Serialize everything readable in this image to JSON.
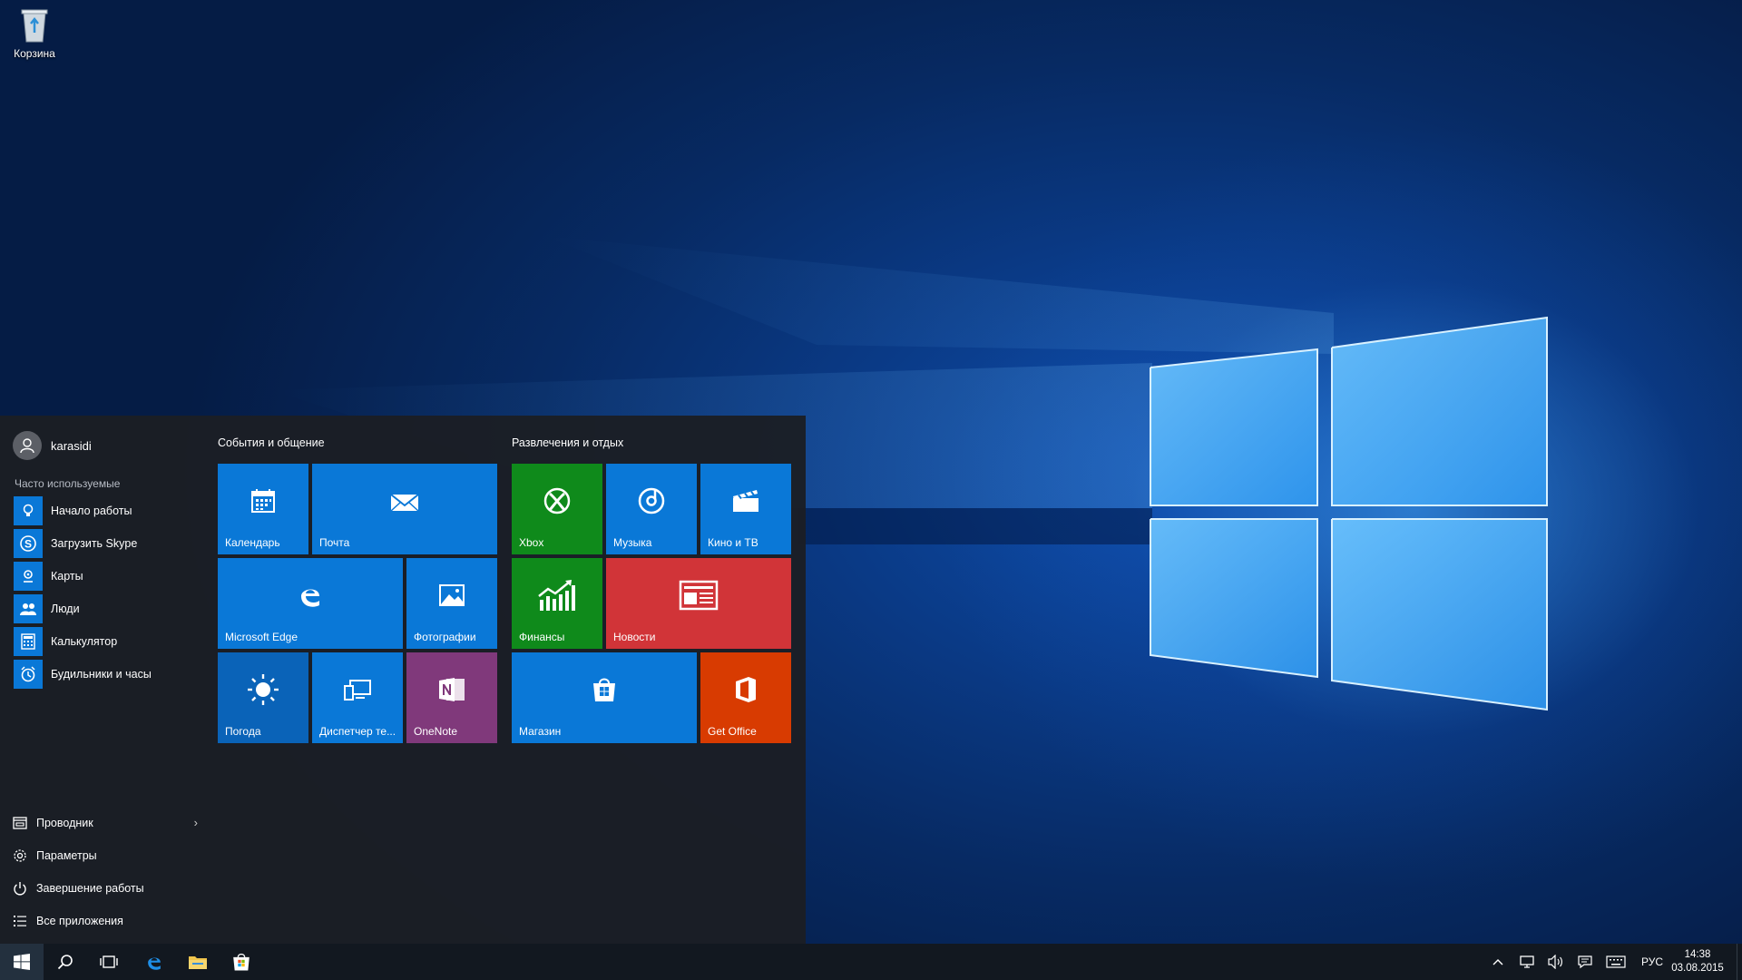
{
  "desktop": {
    "recycle_bin_label": "Корзина"
  },
  "start_menu": {
    "user_name": "karasidi",
    "frequent_title": "Часто используемые",
    "frequent_apps": [
      {
        "label": "Начало работы",
        "icon": "lightbulb-icon"
      },
      {
        "label": "Загрузить Skype",
        "icon": "skype-icon"
      },
      {
        "label": "Карты",
        "icon": "maps-icon"
      },
      {
        "label": "Люди",
        "icon": "people-icon"
      },
      {
        "label": "Калькулятор",
        "icon": "calculator-icon"
      },
      {
        "label": "Будильники и часы",
        "icon": "alarm-clock-icon"
      }
    ],
    "bottom_items": [
      {
        "label": "Проводник",
        "icon": "file-explorer-icon"
      },
      {
        "label": "Параметры",
        "icon": "gear-icon"
      },
      {
        "label": "Завершение работы",
        "icon": "power-icon"
      },
      {
        "label": "Все приложения",
        "icon": "all-apps-icon"
      }
    ],
    "groups": [
      {
        "title": "События и общение",
        "tiles": [
          {
            "label": "Календарь",
            "icon": "calendar-icon",
            "color": "#0a78d7"
          },
          {
            "label": "Почта",
            "icon": "mail-icon",
            "color": "#0a78d7"
          },
          {
            "label": "Microsoft Edge",
            "icon": "edge-icon",
            "color": "#0a78d7"
          },
          {
            "label": "Фотографии",
            "icon": "photos-icon",
            "color": "#0a78d7"
          },
          {
            "label": "Погода",
            "icon": "weather-sun-icon",
            "color": "#0a63b8"
          },
          {
            "label": "Диспетчер те...",
            "icon": "phone-companion-icon",
            "color": "#0a78d7"
          },
          {
            "label": "OneNote",
            "icon": "onenote-icon",
            "color": "#80397b"
          }
        ]
      },
      {
        "title": "Развлечения и отдых",
        "tiles": [
          {
            "label": "Xbox",
            "icon": "xbox-icon",
            "color": "#0f8a1b"
          },
          {
            "label": "Музыка",
            "icon": "music-icon",
            "color": "#0a78d7"
          },
          {
            "label": "Кино и ТВ",
            "icon": "movies-icon",
            "color": "#0a78d7"
          },
          {
            "label": "Финансы",
            "icon": "finance-icon",
            "color": "#0f8a1b"
          },
          {
            "label": "Новости",
            "icon": "news-icon",
            "color": "#d13438"
          },
          {
            "label": "Магазин",
            "icon": "store-icon",
            "color": "#0a78d7"
          },
          {
            "label": "Get Office",
            "icon": "office-icon",
            "color": "#d83b01"
          }
        ]
      }
    ]
  },
  "taskbar": {
    "pinned": [
      "start-icon",
      "search-icon",
      "task-view-icon",
      "edge-icon",
      "file-explorer-icon",
      "store-icon"
    ],
    "tray": [
      "show-hidden-icon",
      "network-icon",
      "volume-icon",
      "action-center-icon",
      "keyboard-icon"
    ],
    "language": "РУС",
    "time": "14:38",
    "date": "03.08.2015"
  }
}
